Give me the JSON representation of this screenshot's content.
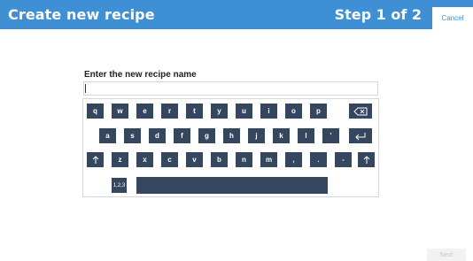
{
  "header": {
    "title": "Create new recipe",
    "step": "Step 1 of 2",
    "cancel_label": "Cancel"
  },
  "form": {
    "label": "Enter the new recipe name",
    "value": "",
    "placeholder": ""
  },
  "keyboard": {
    "row1": [
      "q",
      "w",
      "e",
      "r",
      "t",
      "y",
      "u",
      "i",
      "o",
      "p"
    ],
    "row2": [
      "a",
      "s",
      "d",
      "f",
      "g",
      "h",
      "j",
      "k",
      "l",
      "'"
    ],
    "row3": [
      "z",
      "x",
      "c",
      "v",
      "b",
      "n",
      "m",
      ",",
      ".",
      "-"
    ],
    "numbers_label": "1,2,3",
    "icons": {
      "backspace": "backspace-icon",
      "enter": "enter-icon",
      "shift": "shift-icon"
    }
  },
  "footer": {
    "next_label": "Next"
  },
  "colors": {
    "header_bg": "#3e8fd4",
    "key_bg": "#35475f",
    "border": "#d6d6d6"
  }
}
